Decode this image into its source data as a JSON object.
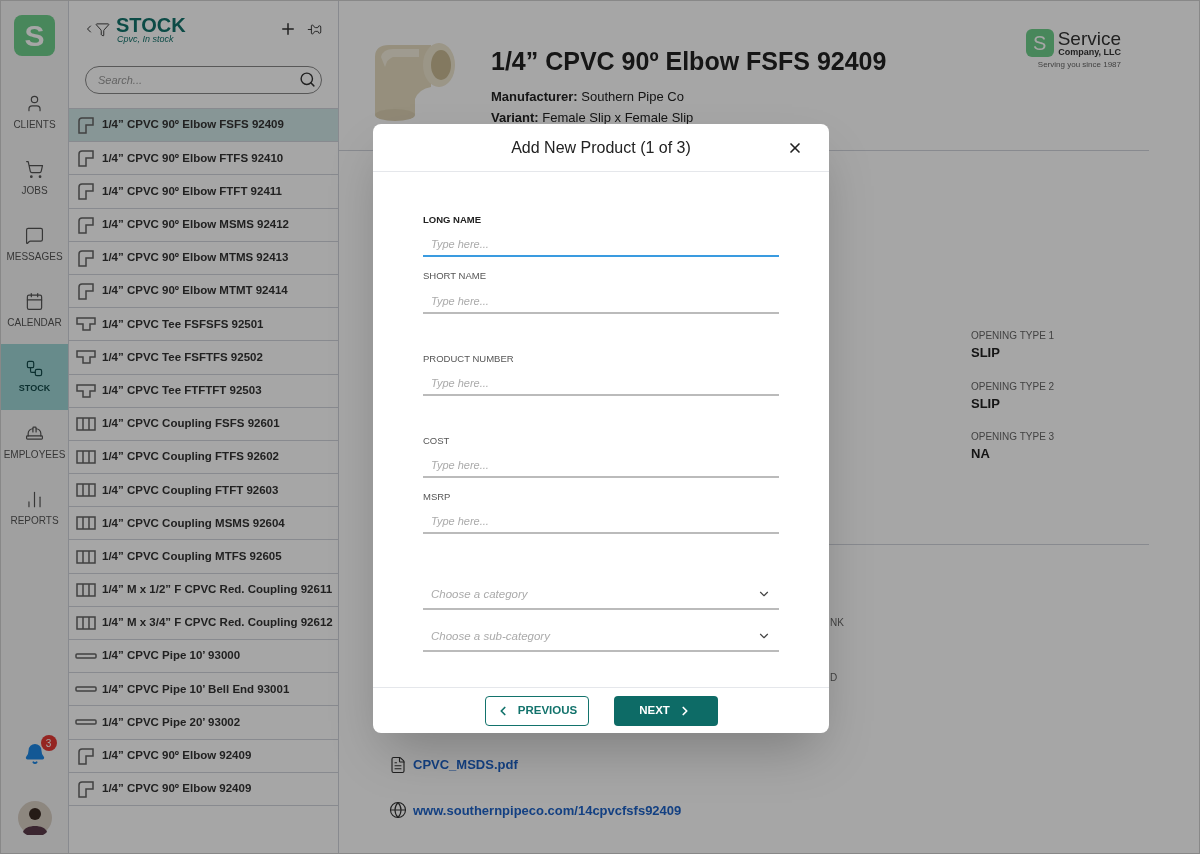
{
  "nav": {
    "logo": "S",
    "items": [
      {
        "label": "CLIENTS",
        "selected": false
      },
      {
        "label": "JOBS",
        "selected": false
      },
      {
        "label": "MESSAGES",
        "selected": false
      },
      {
        "label": "CALENDAR",
        "selected": false
      },
      {
        "label": "STOCK",
        "selected": true
      },
      {
        "label": "EMPLOYEES",
        "selected": false
      },
      {
        "label": "REPORTS",
        "selected": false
      }
    ],
    "notifications": "3"
  },
  "list_panel": {
    "title": "STOCK",
    "subtitle": "Cpvc, In stock",
    "search": {
      "placeholder": "Search..."
    },
    "items": [
      {
        "label": "1/4” CPVC 90º Elbow FSFS 92409",
        "kind": "elbow",
        "selected": true
      },
      {
        "label": "1/4” CPVC 90º Elbow FTFS 92410",
        "kind": "elbow",
        "selected": false
      },
      {
        "label": "1/4” CPVC 90º Elbow FTFT 92411",
        "kind": "elbow",
        "selected": false
      },
      {
        "label": "1/4” CPVC 90º Elbow MSMS 92412",
        "kind": "elbow",
        "selected": false
      },
      {
        "label": "1/4” CPVC 90º Elbow MTMS 92413",
        "kind": "elbow",
        "selected": false
      },
      {
        "label": "1/4” CPVC 90º Elbow MTMT 92414",
        "kind": "elbow",
        "selected": false
      },
      {
        "label": "1/4” CPVC Tee FSFSFS 92501",
        "kind": "tee",
        "selected": false
      },
      {
        "label": "1/4” CPVC Tee FSFTFS 92502",
        "kind": "tee",
        "selected": false
      },
      {
        "label": "1/4” CPVC Tee FTFTFT 92503",
        "kind": "tee",
        "selected": false
      },
      {
        "label": "1/4” CPVC Coupling FSFS 92601",
        "kind": "coupling",
        "selected": false
      },
      {
        "label": "1/4” CPVC Coupling FTFS 92602",
        "kind": "coupling",
        "selected": false
      },
      {
        "label": "1/4” CPVC Coupling FTFT 92603",
        "kind": "coupling",
        "selected": false
      },
      {
        "label": "1/4” CPVC Coupling MSMS 92604",
        "kind": "coupling",
        "selected": false
      },
      {
        "label": "1/4” CPVC Coupling MTFS 92605",
        "kind": "coupling",
        "selected": false
      },
      {
        "label": "1/4” M x 1/2” F CPVC Red. Coupling 92611",
        "kind": "coupling",
        "selected": false
      },
      {
        "label": "1/4” M x 3/4” F CPVC Red. Coupling 92612",
        "kind": "coupling",
        "selected": false
      },
      {
        "label": "1/4” CPVC Pipe 10’ 93000",
        "kind": "pipe",
        "selected": false
      },
      {
        "label": "1/4” CPVC Pipe 10’ Bell End 93001",
        "kind": "pipe",
        "selected": false
      },
      {
        "label": "1/4” CPVC Pipe 20’ 93002",
        "kind": "pipe",
        "selected": false
      },
      {
        "label": "1/4” CPVC 90º Elbow 92409",
        "kind": "elbow",
        "selected": false
      },
      {
        "label": "1/4” CPVC 90º Elbow 92409",
        "kind": "elbow",
        "selected": false
      }
    ]
  },
  "product": {
    "title": "1/4” CPVC 90º Elbow FSFS 92409",
    "details": [
      {
        "label": "Manufacturer:",
        "value": "Southern Pipe Co"
      },
      {
        "label": "Variant:",
        "value": "Female Slip x Female Slip"
      }
    ],
    "attributes": [
      {
        "label": "OPENING TYPE 1",
        "value": "SLIP"
      },
      {
        "label": "OPENING TYPE 2",
        "value": "SLIP"
      },
      {
        "label": "OPENING TYPE 3",
        "value": "NA"
      }
    ],
    "partial_labels": [
      "NK",
      "D"
    ],
    "links": [
      {
        "kind": "file",
        "text": "CPVC_MSDS.pdf"
      },
      {
        "kind": "web",
        "text": "www.southernpipeco.com/14cpvcfsfs92409"
      }
    ]
  },
  "company_logo": {
    "letter": "S",
    "name": "Service",
    "suffix": "Company, LLC",
    "tagline": "Serving you since 1987"
  },
  "dialog": {
    "title": "Add New Product (1 of 3)",
    "fields": [
      {
        "kind": "text",
        "label": "LONG NAME",
        "placeholder": "Type here...",
        "focused": true
      },
      {
        "kind": "text",
        "label": "SHORT  NAME",
        "placeholder": "Type here...",
        "focused": false
      },
      {
        "kind": "text",
        "label": "PRODUCT NUMBER",
        "placeholder": "Type here...",
        "focused": false
      },
      {
        "kind": "text",
        "label": "COST",
        "placeholder": "Type here...",
        "focused": false
      },
      {
        "kind": "text",
        "label": "MSRP",
        "placeholder": "Type here...",
        "focused": false
      },
      {
        "kind": "select",
        "placeholder": "Choose a category"
      },
      {
        "kind": "select",
        "placeholder": "Choose a sub-category"
      }
    ],
    "buttons": [
      {
        "kind": "previous",
        "label": "PREVIOUS"
      },
      {
        "kind": "next",
        "label": "NEXT"
      }
    ]
  }
}
